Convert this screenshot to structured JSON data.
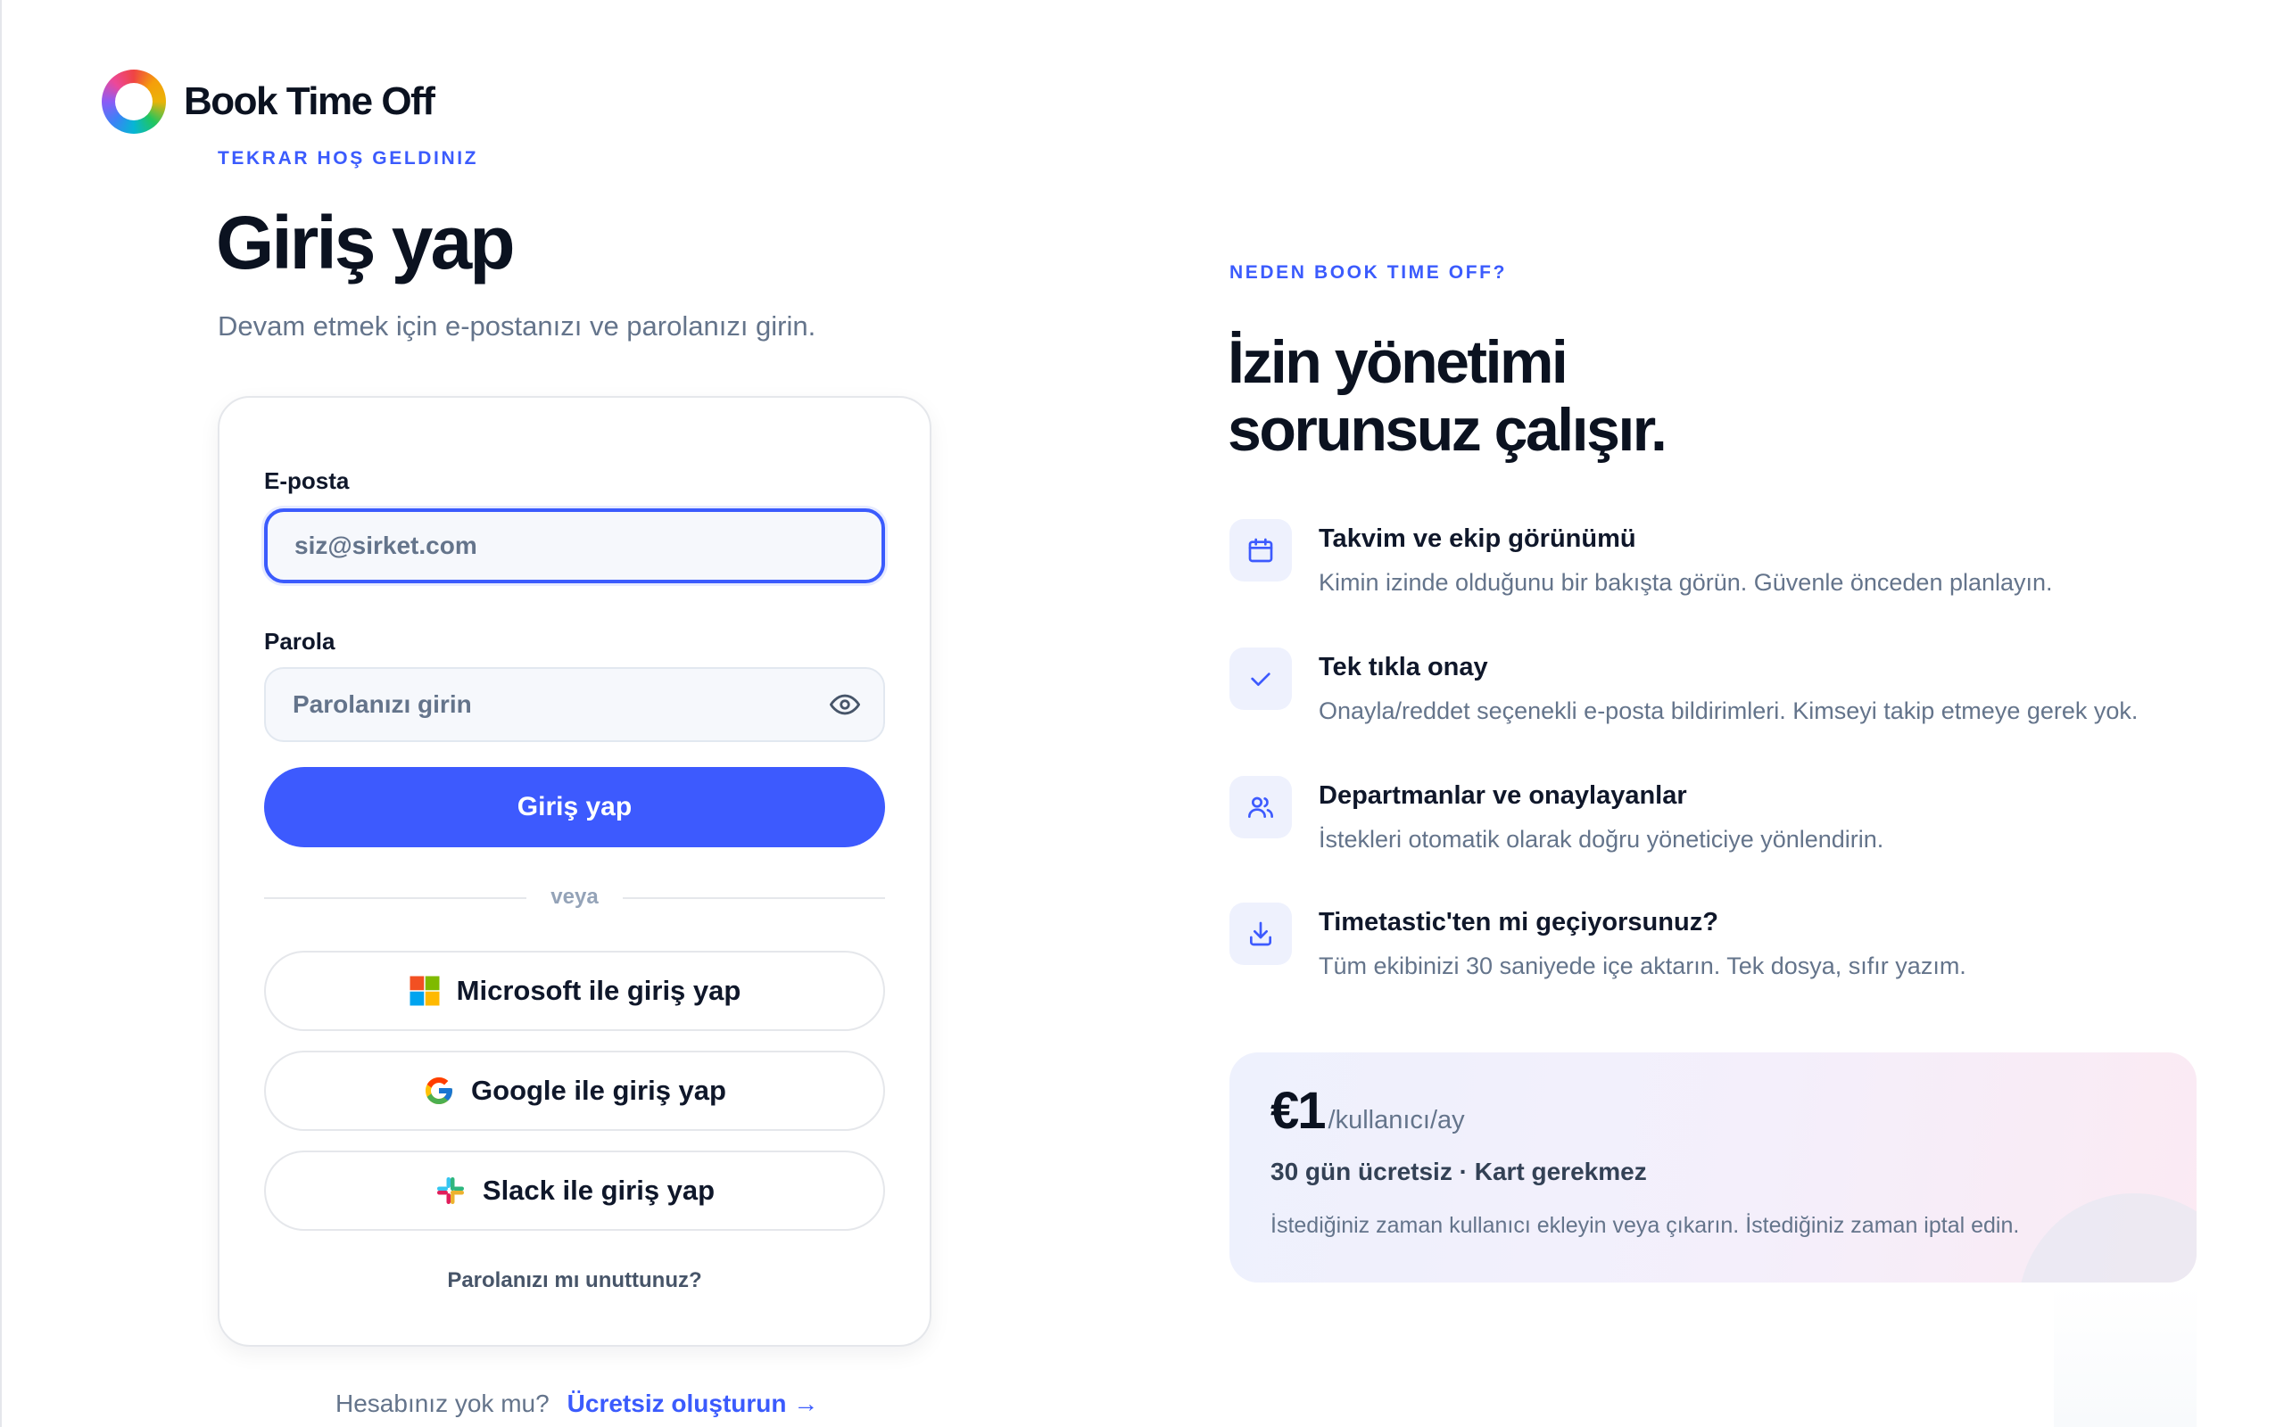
{
  "brand": {
    "name": "Book Time Off"
  },
  "login": {
    "eyebrow": "TEKRAR HOŞ GELDINIZ",
    "title": "Giriş yap",
    "subtitle": "Devam etmek için e-postanızı ve parolanızı girin.",
    "email_label": "E-posta",
    "email_placeholder": "siz@sirket.com",
    "password_label": "Parola",
    "password_placeholder": "Parolanızı girin",
    "submit_label": "Giriş yap",
    "divider": "veya",
    "sso": [
      {
        "label": "Microsoft ile giriş yap",
        "icon": "microsoft-icon"
      },
      {
        "label": "Google ile giriş yap",
        "icon": "google-icon"
      },
      {
        "label": "Slack ile giriş yap",
        "icon": "slack-icon"
      }
    ],
    "forgot_label": "Parolanızı mı unuttunuz?",
    "signup_prompt": "Hesabınız yok mu?",
    "signup_link": "Ücretsiz oluşturun →"
  },
  "promo": {
    "eyebrow": "NEDEN BOOK TIME OFF?",
    "headline_line1": "İzin yönetimi",
    "headline_line2": "sorunsuz çalışır.",
    "features": [
      {
        "icon": "calendar-icon",
        "title": "Takvim ve ekip görünümü",
        "desc": "Kimin izinde olduğunu bir bakışta görün. Güvenle önceden planlayın."
      },
      {
        "icon": "check-icon",
        "title": "Tek tıkla onay",
        "desc": "Onayla/reddet seçenekli e-posta bildirimleri. Kimseyi takip etmeye gerek yok."
      },
      {
        "icon": "users-icon",
        "title": "Departmanlar ve onaylayanlar",
        "desc": "İstekleri otomatik olarak doğru yöneticiye yönlendirin."
      },
      {
        "icon": "download-icon",
        "title": "Timetastic'ten mi geçiyorsunuz?",
        "desc": "Tüm ekibinizi 30 saniyede içe aktarın. Tek dosya, sıfır yazım."
      }
    ],
    "pricing": {
      "price": "€1",
      "unit": "/kullanıcı/ay",
      "trial": "30 gün ücretsiz · Kart gerekmez",
      "note": "İstediğiniz zaman kullanıcı ekleyin veya çıkarın. İstediğiniz zaman iptal edin."
    }
  },
  "colors": {
    "accent": "#3d5afe",
    "text_primary": "#0b1220",
    "text_muted": "#64748b",
    "icon_bg": "#eef1fd"
  }
}
